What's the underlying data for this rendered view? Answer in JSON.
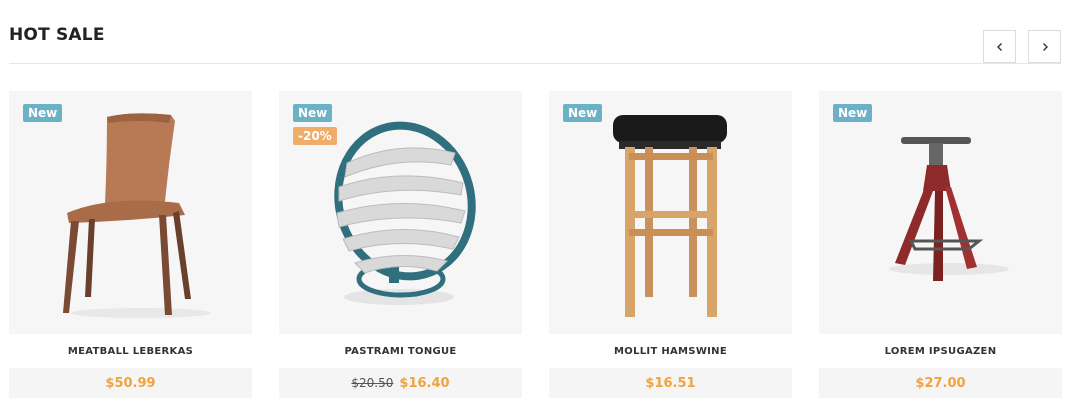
{
  "section": {
    "title": "HOT SALE"
  },
  "navigation": {
    "prev_icon": "chevron-left-icon",
    "next_icon": "chevron-right-icon"
  },
  "colors": {
    "new_badge": "#6bb2c6",
    "sale_badge": "#f0ad6a",
    "price": "#f0a33f"
  },
  "products": [
    {
      "name": "MEATBALL LEBERKAS",
      "badge_new": "New",
      "badge_sale": "",
      "old_price": "",
      "price": "$50.99",
      "image": "wooden-chair"
    },
    {
      "name": "PASTRAMI TONGUE",
      "badge_new": "New",
      "badge_sale": "-20%",
      "old_price": "$20.50",
      "price": "$16.40",
      "image": "striped-sphere-chair"
    },
    {
      "name": "MOLLIT HAMSWINE",
      "badge_new": "New",
      "badge_sale": "",
      "old_price": "",
      "price": "$16.51",
      "image": "wooden-bar-stool"
    },
    {
      "name": "LOREM IPSUGAZEN",
      "badge_new": "New",
      "badge_sale": "",
      "old_price": "",
      "price": "$27.00",
      "image": "red-tripod-stool"
    }
  ]
}
